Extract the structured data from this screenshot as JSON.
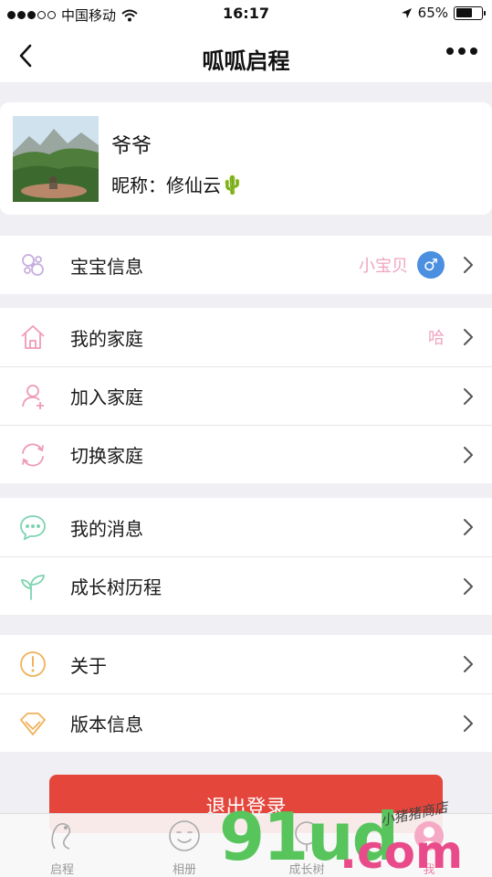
{
  "status_bar": {
    "carrier": "中国移动",
    "time": "16:17",
    "battery_percent": "65%",
    "battery_level": 0.65
  },
  "nav": {
    "title": "呱呱启程"
  },
  "profile": {
    "name": "爷爷",
    "nickname_label": "昵称：",
    "nickname": "修仙云",
    "nickname_emoji": "🌵"
  },
  "groups": {
    "baby": {
      "label": "宝宝信息",
      "baby_name": "小宝贝",
      "gender_symbol": "♂"
    },
    "family": [
      {
        "label": "我的家庭",
        "value": "哈"
      },
      {
        "label": "加入家庭"
      },
      {
        "label": "切换家庭"
      }
    ],
    "messages": [
      {
        "label": "我的消息"
      },
      {
        "label": "成长树历程"
      }
    ],
    "about": [
      {
        "label": "关于"
      },
      {
        "label": "版本信息"
      }
    ]
  },
  "logout": {
    "label": "退出登录"
  },
  "tabs": [
    {
      "label": "启程"
    },
    {
      "label": "相册"
    },
    {
      "label": "成长树"
    },
    {
      "label": "我"
    }
  ],
  "colors": {
    "logout_bg": "#e5463c",
    "pink_icon": "#ef9ab8",
    "green_icon": "#7dd3b0",
    "orange_icon": "#f0b25a",
    "gender_blue": "#4a8fe0"
  },
  "watermark": {
    "main": "91ud",
    "suffix": ".com",
    "sub": "小猪猪商店"
  }
}
